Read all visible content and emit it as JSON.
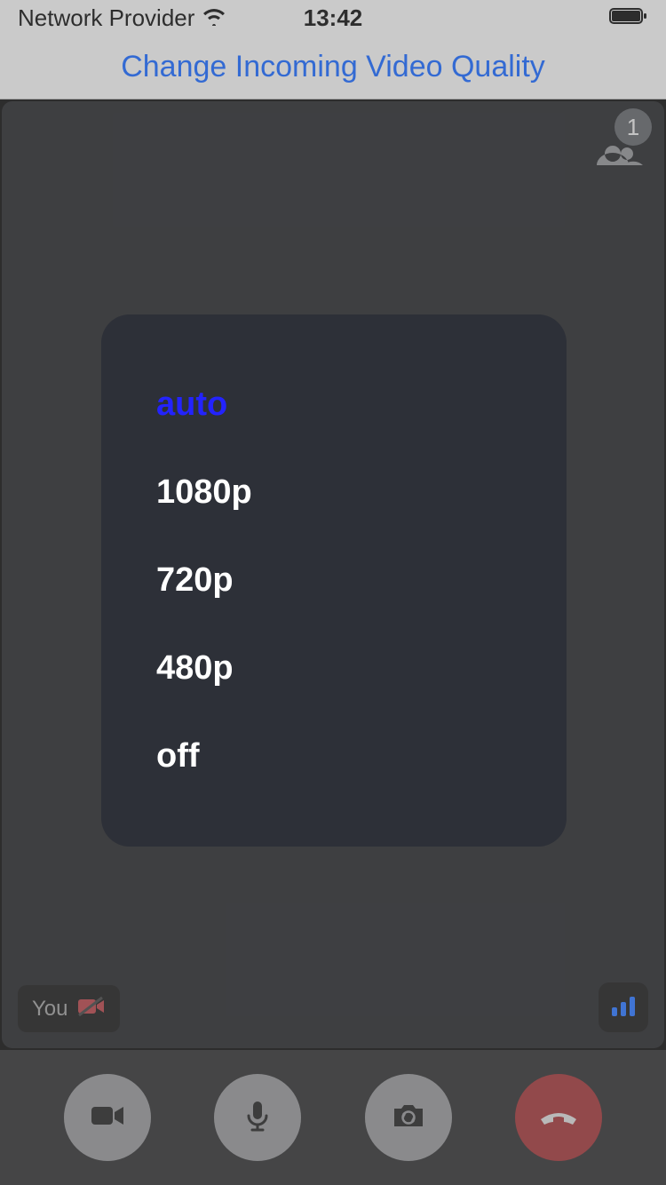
{
  "status_bar": {
    "provider": "Network Provider",
    "time": "13:42"
  },
  "header": {
    "title": "Change Incoming Video Quality"
  },
  "participants": {
    "count": "1"
  },
  "quality_menu": {
    "options": [
      {
        "label": "auto",
        "selected": true
      },
      {
        "label": "1080p",
        "selected": false
      },
      {
        "label": "720p",
        "selected": false
      },
      {
        "label": "480p",
        "selected": false
      },
      {
        "label": "off",
        "selected": false
      }
    ]
  },
  "self_view": {
    "label": "You"
  },
  "colors": {
    "accent": "#0a5fff",
    "selected_option": "#2323ff",
    "popup_bg": "#2d3038",
    "video_bg": "#1b1c20",
    "hangup": "#9c2b2f"
  }
}
